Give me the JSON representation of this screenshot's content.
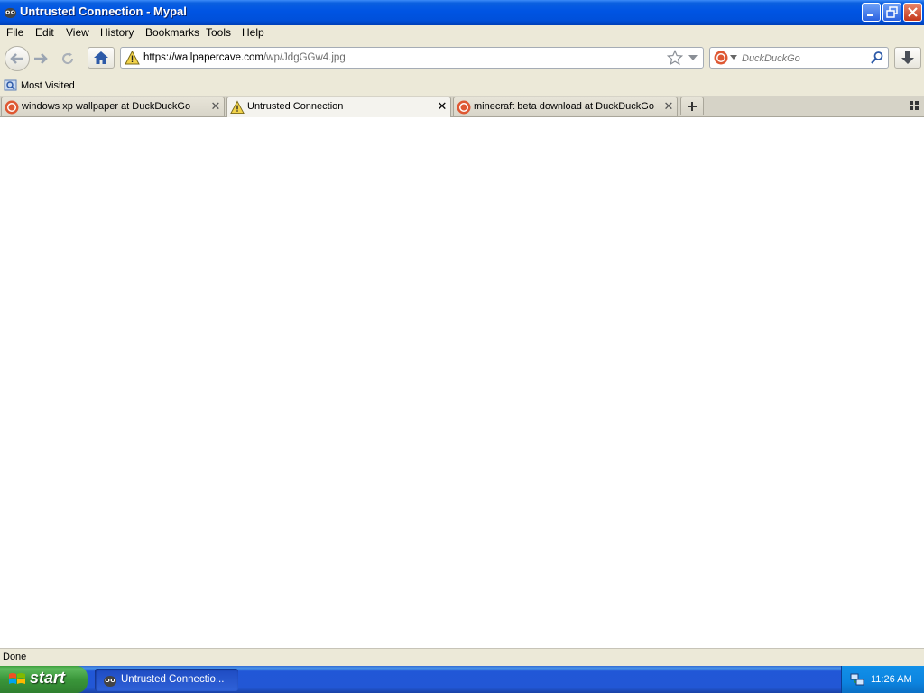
{
  "window": {
    "title": "Untrusted Connection - Mypal"
  },
  "menu": [
    "File",
    "Edit",
    "View",
    "History",
    "Bookmarks",
    "Tools",
    "Help"
  ],
  "navbar": {
    "url_host": "https://wallpapercave.com",
    "url_path": "/wp/JdgGGw4.jpg",
    "search_placeholder": "DuckDuckGo"
  },
  "bookmarks": {
    "most_visited": "Most Visited"
  },
  "tabs": [
    {
      "label": "windows xp wallpaper at DuckDuckGo",
      "icon": "duckduckgo-icon"
    },
    {
      "label": "Untrusted Connection",
      "icon": "warning-icon",
      "active": true
    },
    {
      "label": "minecraft beta download at DuckDuckGo",
      "icon": "duckduckgo-icon"
    }
  ],
  "status": "Done",
  "taskbar": {
    "start": "start",
    "tasks": [
      {
        "label": "Untrusted Connectio..."
      }
    ],
    "clock": "11:26 AM"
  },
  "colors": {
    "titlebar": "#0054e3",
    "chrome": "#ece9d8",
    "taskbar": "#2257d5",
    "start": "#3a963a",
    "tray": "#0c84e0"
  }
}
